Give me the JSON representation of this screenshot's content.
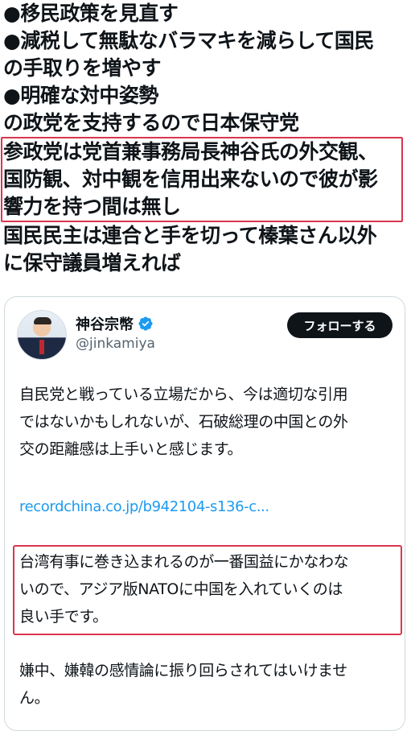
{
  "post": {
    "lines": [
      "●移民政策を見直す",
      "●減税して無駄なバラマキを減らして国民",
      "の手取りを増やす",
      "●明確な対中姿勢",
      "の政党を支持するので日本保守党"
    ],
    "highlighted_lines": [
      "参政党は党首兼事務局長神谷氏の外交観、",
      "国防観、対中観を信用出来ないので彼が影",
      "響力を持つ間は無し"
    ],
    "after_lines": [
      "国民民主は連合と手を切って榛葉さん以外",
      "に保守議員増えれば"
    ]
  },
  "quoted_tweet": {
    "display_name": "神谷宗幣",
    "handle": "@jinkamiya",
    "follow_label": "フォローする",
    "paragraph1_lines": [
      "自民党と戦っている立場だから、今は適切な引用",
      "ではないかもしれないが、石破総理の中国との外",
      "交の距離感は上手いと感じます。"
    ],
    "link": "recordchina.co.jp/b942104-s136-c...",
    "paragraph2_lines": [
      "台湾有事に巻き込まれるのが一番国益にかなわな",
      "いので、アジア版NATOに中国を入れていくのは",
      "良い手です。"
    ],
    "paragraph3_lines": [
      "嫌中、嫌韓の感情論に振り回らされてはいけませ",
      "ん。"
    ]
  },
  "colors": {
    "highlight_border": "#d9364f",
    "link": "#1d9bf0",
    "verified": "#1d9bf0",
    "follow_bg": "#0f1419"
  },
  "icons": [
    "verified-badge-icon"
  ]
}
